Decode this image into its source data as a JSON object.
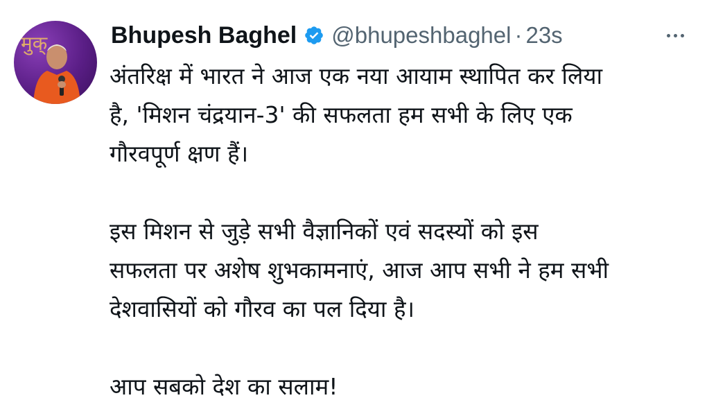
{
  "tweet": {
    "author_name": "Bhupesh Baghel",
    "handle": "@bhupeshbaghel",
    "separator": "·",
    "time": "23s",
    "verified": true,
    "verified_color": "#1d9bf0",
    "avatar_alt_text_visible": "मुक्",
    "paragraphs": [
      {
        "lines": [
          "अंतरिक्ष में भारत ने आज एक नया आयाम स्थापित कर लिया",
          "है, 'मिशन चंद्रयान-3' की सफलता हम सभी के लिए एक",
          "गौरवपूर्ण क्षण हैं।"
        ]
      },
      {
        "lines": [
          "इस मिशन से जुड़े सभी वैज्ञानिकों एवं सदस्यों को इस",
          "सफलता पर अशेष शुभकामनाएं, आज आप सभी ने हम सभी",
          "देशवासियों को गौरव का पल दिया है।"
        ]
      },
      {
        "lines": [
          "आप सबको देश का सलाम!"
        ]
      }
    ]
  },
  "icons": {
    "verified": "verified-badge-icon",
    "more": "more-options-icon"
  }
}
